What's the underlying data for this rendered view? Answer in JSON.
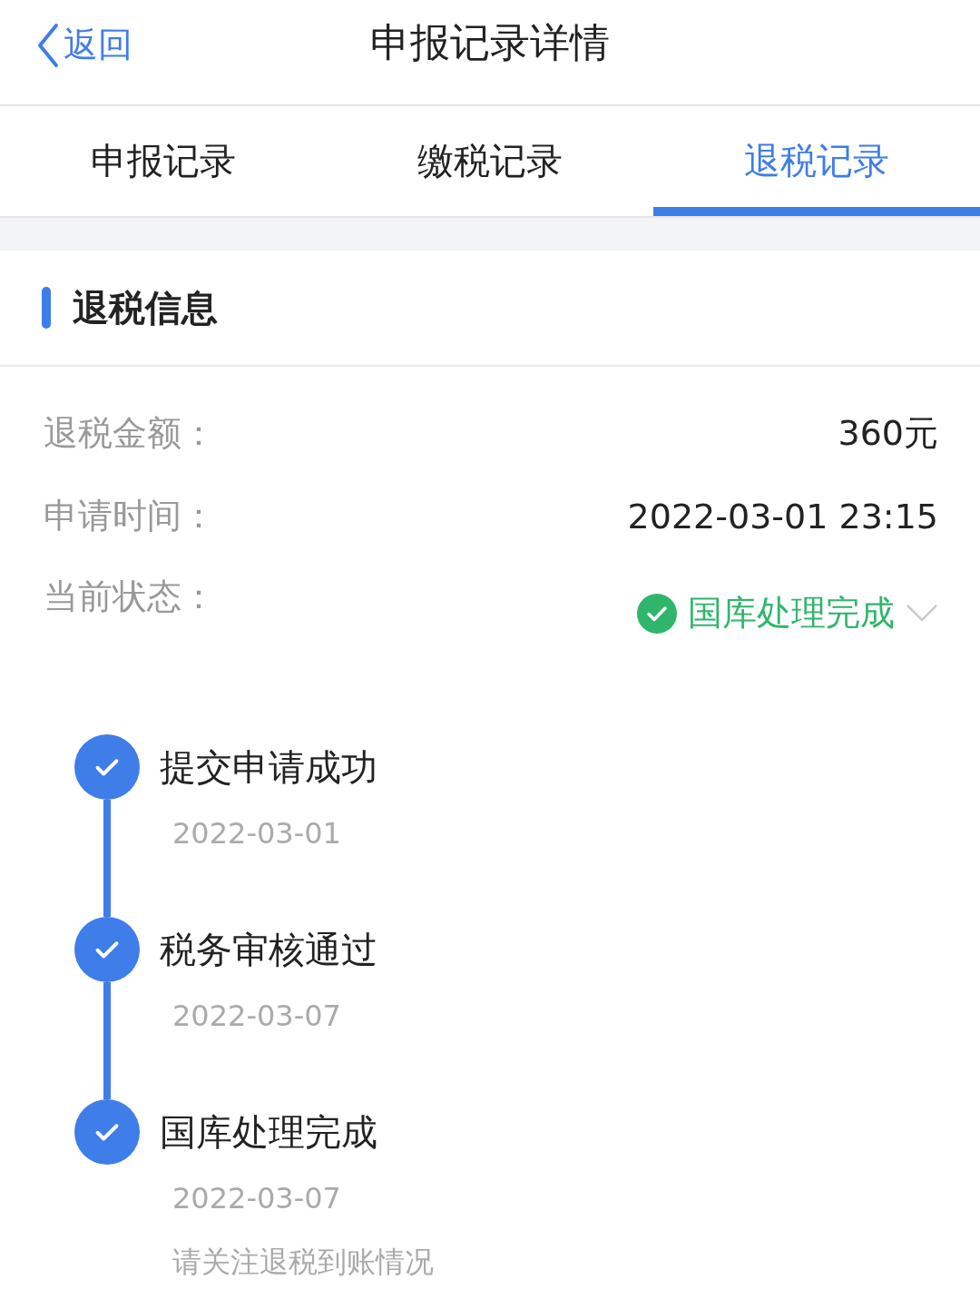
{
  "header": {
    "back": "返回",
    "title": "申报记录详情"
  },
  "tabs": [
    {
      "label": "申报记录",
      "selected": false
    },
    {
      "label": "缴税记录",
      "selected": false
    },
    {
      "label": "退税记录",
      "selected": true
    }
  ],
  "section": {
    "title": "退税信息"
  },
  "fields": [
    {
      "kind": "text",
      "label": "退税金额：",
      "value": "360元"
    },
    {
      "kind": "text",
      "label": "申请时间：",
      "value": "2022-03-01 23:15"
    },
    {
      "kind": "status",
      "label": "当前状态：",
      "value": "国库处理完成",
      "expanded": false
    }
  ],
  "timeline": [
    {
      "title": "提交申请成功",
      "date": "2022-03-01",
      "done": true
    },
    {
      "title": "税务审核通过",
      "date": "2022-03-07",
      "done": true
    },
    {
      "title": "国库处理完成",
      "date": "2022-03-07",
      "done": true,
      "note": "请关注退税到账情况"
    }
  ]
}
